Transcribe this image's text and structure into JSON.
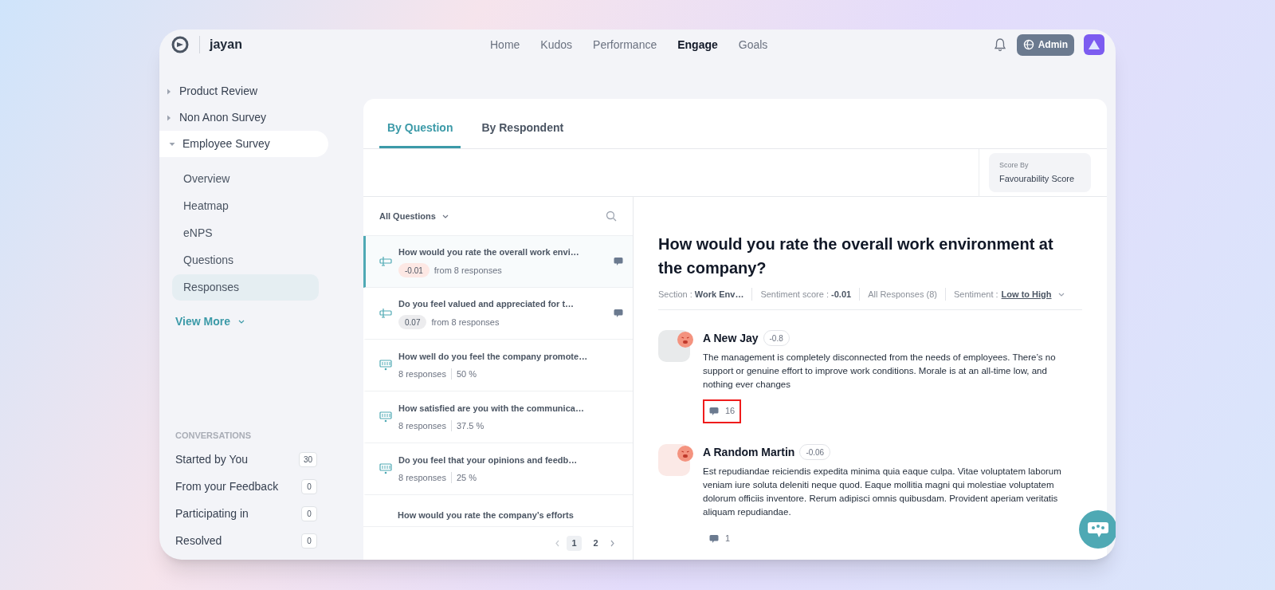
{
  "app": {
    "name": "jayan"
  },
  "nav": [
    {
      "label": "Home",
      "selected": false
    },
    {
      "label": "Kudos",
      "selected": false
    },
    {
      "label": "Performance",
      "selected": false
    },
    {
      "label": "Engage",
      "selected": true
    },
    {
      "label": "Goals",
      "selected": false
    }
  ],
  "admin_button": "Admin",
  "sidebar": {
    "surveys": [
      {
        "label": "Product Review",
        "expanded": false
      },
      {
        "label": "Non Anon Survey",
        "expanded": false
      },
      {
        "label": "Employee Survey",
        "expanded": true,
        "children": [
          {
            "label": "Overview",
            "selected": false
          },
          {
            "label": "Heatmap",
            "selected": false
          },
          {
            "label": "eNPS",
            "selected": false
          },
          {
            "label": "Questions",
            "selected": false
          },
          {
            "label": "Responses",
            "selected": true
          }
        ]
      }
    ],
    "view_more": "View More",
    "conversations": {
      "heading": "CONVERSATIONS",
      "items": [
        {
          "label": "Started by You",
          "count": "30"
        },
        {
          "label": "From your Feedback",
          "count": "0"
        },
        {
          "label": "Participating in",
          "count": "0"
        },
        {
          "label": "Resolved",
          "count": "0"
        }
      ]
    }
  },
  "tabs": [
    {
      "label": "By Question",
      "selected": true
    },
    {
      "label": "By Respondent",
      "selected": false
    }
  ],
  "score_by": {
    "label": "Score By",
    "value": "Favourability Score"
  },
  "questions": {
    "filter": "All Questions",
    "items": [
      {
        "kind": "sentiment",
        "title": "How would you rate the overall work envi…",
        "score": "-0.01",
        "color": "#fde8e4",
        "note": "from 8 responses",
        "has_comments": true,
        "selected": true
      },
      {
        "kind": "sentiment",
        "title": "Do you feel valued and appreciated for t…",
        "score": "0.07",
        "color": "#ececee",
        "note": "from 8 responses",
        "has_comments": true,
        "selected": false
      },
      {
        "kind": "choice",
        "title": "How well do you feel the company promote…",
        "responses": "8 responses",
        "percent": "50 %",
        "selected": false
      },
      {
        "kind": "choice",
        "title": "How satisfied are you with the communica…",
        "responses": "8 responses",
        "percent": "37.5 %",
        "selected": false
      },
      {
        "kind": "choice",
        "title": "Do you feel that your opinions and feedb…",
        "responses": "8 responses",
        "percent": "25 %",
        "selected": false
      },
      {
        "kind": "partial",
        "title": "How would you rate the company’s efforts"
      }
    ],
    "pagination": [
      {
        "label": "1",
        "selected": true
      },
      {
        "label": "2",
        "selected": false
      }
    ]
  },
  "detail": {
    "title": "How would you rate the overall work environment at the company?",
    "meta": [
      {
        "kind": "text",
        "text": "Section : **Work Env…**"
      },
      {
        "kind": "text",
        "text": "Sentiment score : **-0.01**"
      },
      {
        "kind": "text",
        "text": "All Responses (8)"
      },
      {
        "kind": "sort",
        "label": "Sentiment :",
        "value": "Low to High"
      }
    ],
    "responses": [
      {
        "name": "A New Jay",
        "score": "-0.8",
        "text": "The management is completely disconnected from the needs of employees. There’s no support or genuine effort to improve work conditions. Morale is at an all-time low, and nothing ever changes",
        "comments": "16",
        "highlighted": true
      },
      {
        "name": "A Random Martin",
        "score": "-0.06",
        "text": "Est repudiandae reiciendis expedita minima quia eaque culpa. Vitae voluptatem laborum veniam iure soluta deleniti neque quod. Eaque mollitia magni qui molestiae voluptatem dolorum officiis inventore. Rerum adipisci omnis quibusdam. Provident aperiam veritatis aliquam repudiandae.",
        "comments": "1",
        "highlighted": false
      }
    ]
  }
}
